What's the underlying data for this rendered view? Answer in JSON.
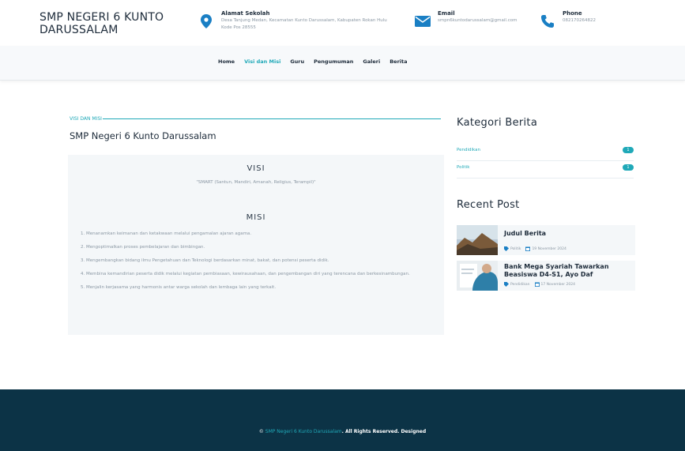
{
  "header": {
    "brand": "SMP NEGERI 6 KUNTO DARUSSALAM",
    "address": {
      "title": "Alamat Sekolah",
      "text": "Desa Tanjung Medan, Kecamatan Kunto Darussalam, Kabupaten Rokan Hulu Kode Pos 28555"
    },
    "email": {
      "title": "Email",
      "text": "smpn6kuntodarussalam@gmail.com"
    },
    "phone": {
      "title": "Phone",
      "text": "082170264822"
    }
  },
  "nav": {
    "items": [
      "Home",
      "Visi dan Misi",
      "Guru",
      "Pengumuman",
      "Galeri",
      "Berita"
    ],
    "active": "Visi dan Misi"
  },
  "content": {
    "section_label": "VISI DAN MISI",
    "page_title": "SMP Negeri 6 Kunto Darussalam",
    "visi_heading": "VISI",
    "visi_text": "\"SMART (Santun, Mandiri, Amanah, Religius, Terampil)\"",
    "misi_heading": "MISI",
    "misi": [
      "1. Menanamkan keimanan dan ketakwaan melalui pengamalan ajaran agama.",
      "2. Mengoptimalkan proses pembelajaran dan bimbingan.",
      "3. Mengembangkan bidang ilmu Pengetahuan dan Teknologi berdasarkan minat, bakat, dan potensi peserta didik.",
      "4. Membina kemandirian peserta didik melalui kegiatan pembiasaan, kewirausahaan, dan pengembangan diri yang terencana dan berkesinambungan.",
      "5. Menjalin kerjasama yang harmonis antar warga sekolah dan lembaga lain yang terkait."
    ]
  },
  "sidebar": {
    "kategori_title": "Kategori Berita",
    "categories": [
      {
        "name": "Pendidikan",
        "count": "1"
      },
      {
        "name": "Politik",
        "count": "1"
      }
    ],
    "recent_title": "Recent Post",
    "posts": [
      {
        "title": "Judul Berita",
        "category": "Politik",
        "date": "19 November 2024"
      },
      {
        "title": "Bank Mega Syariah Tawarkan Beasiswa D4-S1, Ayo Daf",
        "category": "Pendidikan",
        "date": "17 November 2024"
      }
    ]
  },
  "footer": {
    "copyright_prefix": "© ",
    "copyright_link": "SMP Negeri 6 Kunto Darussalam",
    "copyright_rest": ". All Rights Reserved. Designed"
  },
  "colors": {
    "accent": "#20a9b8",
    "footer_bg": "#0c3346",
    "navy": "#1d2b3a"
  },
  "icons": {
    "address": "map-pin-icon",
    "email": "envelope-icon",
    "phone": "phone-icon",
    "post_category": "tag-icon",
    "post_date": "calendar-icon"
  }
}
